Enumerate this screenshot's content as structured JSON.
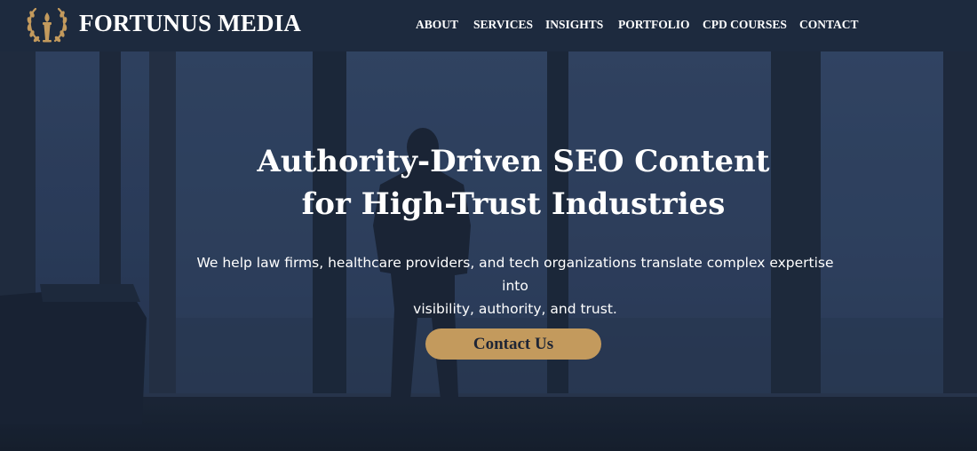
{
  "brand": {
    "name": "FORTUNUS MEDIA",
    "logo_icon": "laurel-torch-icon",
    "logo_color": "#c39a5d"
  },
  "nav": {
    "items": [
      {
        "label": "ABOUT"
      },
      {
        "label": "SERVICES"
      },
      {
        "label": "INSIGHTS"
      },
      {
        "label": "PORTFOLIO"
      },
      {
        "label": "CPD COURSES"
      },
      {
        "label": "CONTACT"
      }
    ]
  },
  "hero": {
    "title_line1": "Authority-Driven SEO Content",
    "title_line2": "for High-Trust Industries",
    "subtitle_line1": "We help law firms, healthcare providers, and tech organizations translate complex expertise into",
    "subtitle_line2": "visibility, authority, and trust.",
    "cta_label": "Contact Us",
    "background_image": "silhouette of man standing at floor-to-ceiling office windows"
  },
  "colors": {
    "header_bg": "#1d2a3e",
    "accent": "#c39a5d",
    "text": "#ffffff"
  }
}
